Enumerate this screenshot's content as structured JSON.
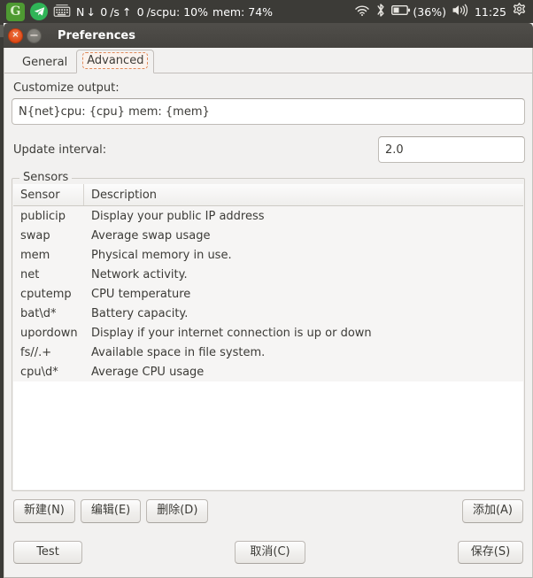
{
  "top_panel": {
    "icons": [
      {
        "name": "gimp-logo-icon",
        "glyph": "G"
      },
      {
        "name": "telegram-icon",
        "glyph": "➤"
      },
      {
        "name": "keyboard-indicator-icon",
        "glyph": "⌨"
      },
      {
        "name": "wifi-icon",
        "glyph": "◠"
      },
      {
        "name": "bluetooth-icon",
        "glyph": "ᛦ"
      },
      {
        "name": "battery-icon",
        "glyph": "▭"
      },
      {
        "name": "volume-icon",
        "glyph": "🔊"
      },
      {
        "name": "system-menu-gear-icon",
        "glyph": "⚙"
      }
    ],
    "net_label": "N",
    "down_arrow": "↓",
    "down_value": "0",
    "down_unit": "/s",
    "up_arrow": "↑",
    "up_value": "0",
    "up_unit": "/s",
    "cpu_text": "cpu: 10%",
    "mem_text": "mem: 74%",
    "battery_text": "(36%)",
    "clock": "11:25"
  },
  "window": {
    "title": "Preferences",
    "close_glyph": "×",
    "minimize_glyph": "−"
  },
  "tabs": [
    {
      "label": "General",
      "active": false
    },
    {
      "label": "Advanced",
      "active": true
    }
  ],
  "form": {
    "customize_output_label": "Customize output:",
    "customize_output_value": "N{net}cpu: {cpu} mem: {mem}",
    "customize_output_placeholder": "",
    "update_interval_label": "Update interval:",
    "update_interval_value": "2.0",
    "update_interval_placeholder": ""
  },
  "sensors_group": {
    "legend": "Sensors",
    "columns": [
      "Sensor",
      "Description"
    ],
    "rows": [
      {
        "sensor": "publicip",
        "description": "Display your public IP address"
      },
      {
        "sensor": "swap",
        "description": "Average swap usage"
      },
      {
        "sensor": "mem",
        "description": "Physical memory in use."
      },
      {
        "sensor": "net",
        "description": "Network activity."
      },
      {
        "sensor": "cputemp",
        "description": "CPU temperature"
      },
      {
        "sensor": "bat\\d*",
        "description": "Battery capacity."
      },
      {
        "sensor": "upordown",
        "description": "Display if your internet connection is up or down"
      },
      {
        "sensor": "fs//.+",
        "description": "Available space in file system."
      },
      {
        "sensor": "cpu\\d*",
        "description": "Average CPU usage"
      }
    ]
  },
  "list_actions": {
    "new": "新建(N)",
    "edit": "编辑(E)",
    "delete": "删除(D)",
    "add": "添加(A)"
  },
  "dialog_actions": {
    "test": "Test",
    "cancel": "取消(C)",
    "save": "保存(S)"
  },
  "colors": {
    "panel_bg": "#3c3b37",
    "accent_orange": "#dd4814",
    "window_bg": "#f2f1f0",
    "text": "#3c3b37",
    "list_bg": "#f6f5f4"
  }
}
